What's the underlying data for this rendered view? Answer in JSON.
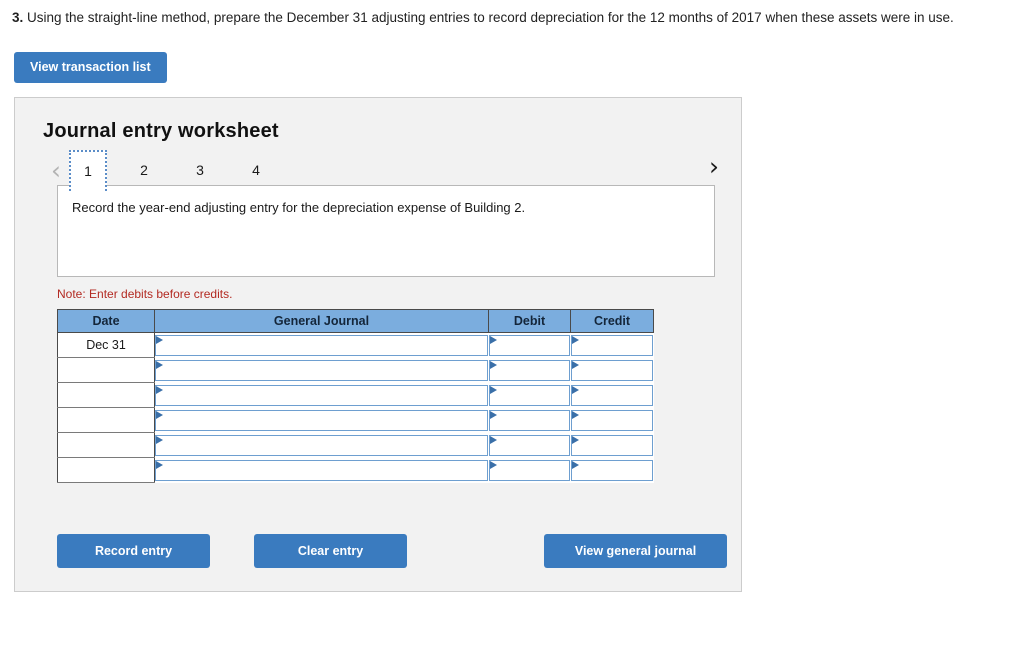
{
  "question": {
    "number": "3.",
    "text": " Using the straight-line method, prepare the December 31 adjusting entries to record depreciation for the 12 months of 2017 when these assets were in use."
  },
  "toolbar": {
    "view_transaction_list": "View transaction list"
  },
  "worksheet": {
    "title": "Journal entry worksheet",
    "prev_arrow": "‹",
    "next_arrow": "›",
    "tabs": [
      {
        "label": "1",
        "active": true
      },
      {
        "label": "2",
        "active": false
      },
      {
        "label": "3",
        "active": false
      },
      {
        "label": "4",
        "active": false
      }
    ],
    "instruction": "Record the year-end adjusting entry for the depreciation expense of Building 2.",
    "note": "Note: Enter debits before credits.",
    "table": {
      "headers": [
        "Date",
        "General Journal",
        "Debit",
        "Credit"
      ],
      "rows": [
        {
          "date": "Dec 31",
          "general_journal": "",
          "debit": "",
          "credit": ""
        },
        {
          "date": "",
          "general_journal": "",
          "debit": "",
          "credit": ""
        },
        {
          "date": "",
          "general_journal": "",
          "debit": "",
          "credit": ""
        },
        {
          "date": "",
          "general_journal": "",
          "debit": "",
          "credit": ""
        },
        {
          "date": "",
          "general_journal": "",
          "debit": "",
          "credit": ""
        },
        {
          "date": "",
          "general_journal": "",
          "debit": "",
          "credit": ""
        }
      ]
    },
    "actions": {
      "record_entry": "Record entry",
      "clear_entry": "Clear entry",
      "view_general_journal": "View general journal"
    }
  },
  "colors": {
    "button_blue": "#3a7bbf",
    "table_header_blue": "#7badde",
    "note_red": "#b32a22",
    "panel_bg": "#f2f2f2",
    "cell_border_blue": "#6e9fd0"
  }
}
